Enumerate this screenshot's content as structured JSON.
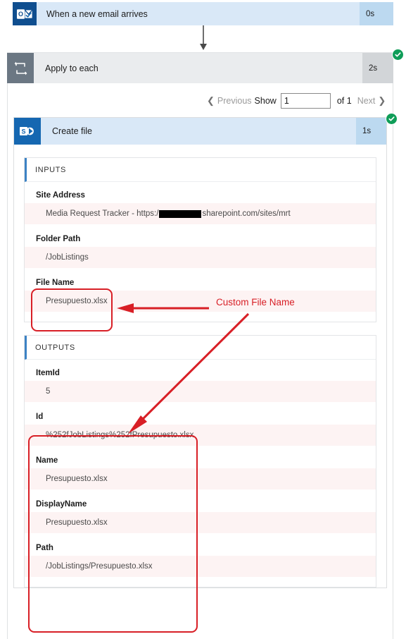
{
  "trigger": {
    "icon": "outlook-icon",
    "title": "When a new email arrives",
    "duration": "0s"
  },
  "loop": {
    "icon": "loop-repeat-icon",
    "title": "Apply to each",
    "duration": "2s",
    "status": "succeeded"
  },
  "pager": {
    "previous_label": "Previous",
    "show_label": "Show",
    "page_value": "1",
    "of_label": "of 1",
    "next_label": "Next"
  },
  "action": {
    "icon": "sharepoint-icon",
    "title": "Create file",
    "duration": "1s",
    "status": "succeeded",
    "inputs": {
      "header": "INPUTS",
      "fields": [
        {
          "label": "Site Address",
          "value_prefix": "Media Request Tracker - https:/",
          "value_suffix": "sharepoint.com/sites/mrt",
          "redacted": true
        },
        {
          "label": "Folder Path",
          "value": "/JobListings"
        },
        {
          "label": "File Name",
          "value": "Presupuesto.xlsx"
        }
      ]
    },
    "outputs": {
      "header": "OUTPUTS",
      "fields": [
        {
          "label": "ItemId",
          "value": "5"
        },
        {
          "label": "Id",
          "value": "%252fJobListings%252fPresupuesto.xlsx"
        },
        {
          "label": "Name",
          "value": "Presupuesto.xlsx"
        },
        {
          "label": "DisplayName",
          "value": "Presupuesto.xlsx"
        },
        {
          "label": "Path",
          "value": "/JobListings/Presupuesto.xlsx"
        }
      ]
    }
  },
  "annotations": {
    "callout_text": "Custom File Name",
    "color": "#d81f26"
  },
  "colors": {
    "trigger_header": "#d9e8f7",
    "trigger_duration": "#bcd9f0",
    "loop_header": "#eaecee",
    "loop_icon": "#6b7783",
    "outlook_blue": "#0f4e8f",
    "sharepoint_blue": "#1567b1",
    "success_green": "#0f9d58",
    "value_bg": "#fdf3f3"
  }
}
